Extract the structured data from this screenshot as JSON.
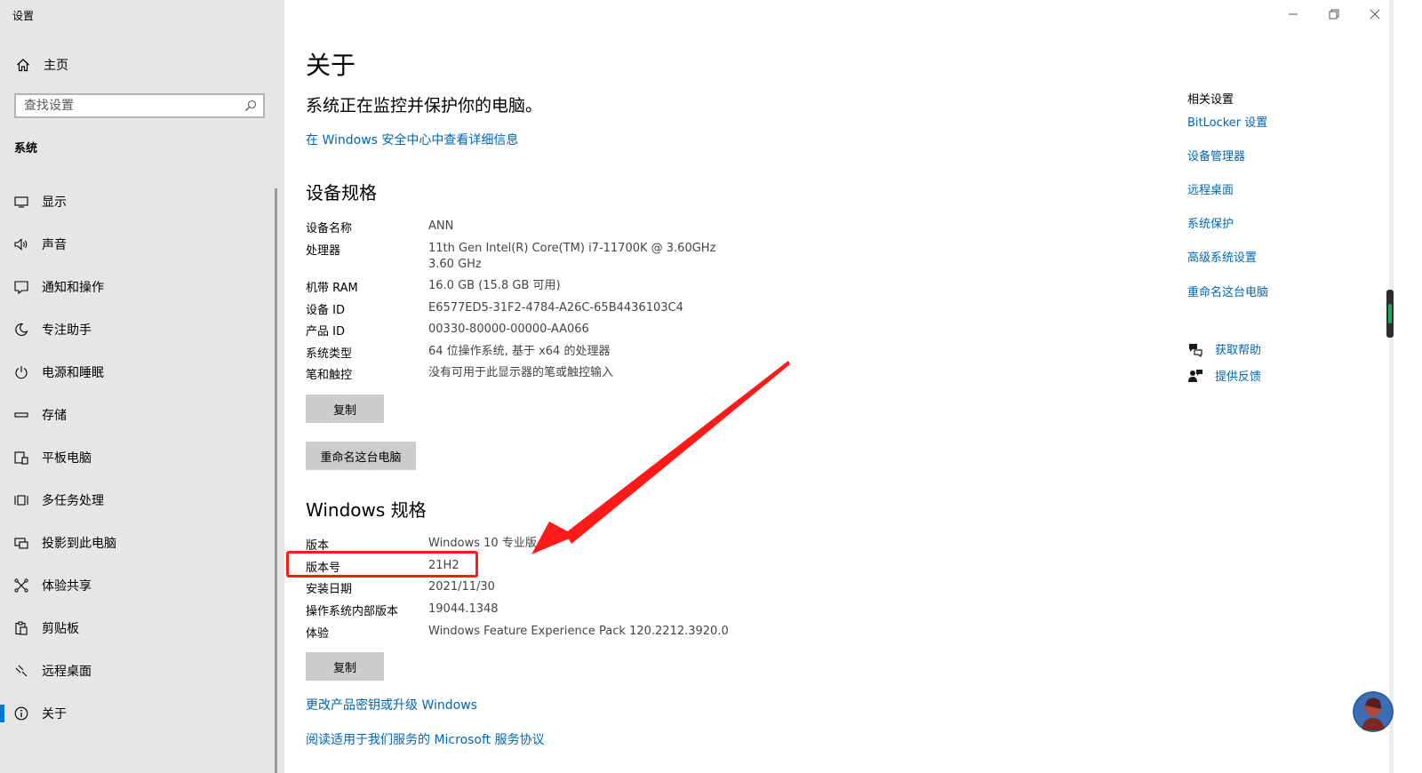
{
  "window": {
    "title": "设置"
  },
  "sidebar": {
    "home_label": "主页",
    "search_placeholder": "查找设置",
    "section_title": "系统",
    "items": [
      {
        "label": "显示",
        "icon": "display-icon"
      },
      {
        "label": "声音",
        "icon": "sound-icon"
      },
      {
        "label": "通知和操作",
        "icon": "notification-icon"
      },
      {
        "label": "专注助手",
        "icon": "focus-assist-icon"
      },
      {
        "label": "电源和睡眠",
        "icon": "power-icon"
      },
      {
        "label": "存储",
        "icon": "storage-icon"
      },
      {
        "label": "平板电脑",
        "icon": "tablet-icon"
      },
      {
        "label": "多任务处理",
        "icon": "multitasking-icon"
      },
      {
        "label": "投影到此电脑",
        "icon": "projecting-icon"
      },
      {
        "label": "体验共享",
        "icon": "shared-experiences-icon"
      },
      {
        "label": "剪贴板",
        "icon": "clipboard-icon"
      },
      {
        "label": "远程桌面",
        "icon": "remote-desktop-icon"
      },
      {
        "label": "关于",
        "icon": "info-icon",
        "selected": true
      }
    ]
  },
  "main": {
    "title": "关于",
    "status": "系统正在监控并保护你的电脑。",
    "security_link": "在 Windows 安全中心中查看详细信息",
    "device_specs": {
      "heading": "设备规格",
      "rows": [
        {
          "key": "设备名称",
          "value": "ANN"
        },
        {
          "key": "处理器",
          "value": "11th Gen Intel(R) Core(TM) i7-11700K @ 3.60GHz",
          "value2": "3.60 GHz"
        },
        {
          "key": "机带 RAM",
          "value": "16.0 GB (15.8 GB 可用)"
        },
        {
          "key": "设备 ID",
          "value": "E6577ED5-31F2-4784-A26C-65B4436103C4"
        },
        {
          "key": "产品 ID",
          "value": "00330-80000-00000-AA066"
        },
        {
          "key": "系统类型",
          "value": "64 位操作系统, 基于 x64 的处理器"
        },
        {
          "key": "笔和触控",
          "value": "没有可用于此显示器的笔或触控输入"
        }
      ],
      "copy_button": "复制",
      "rename_button": "重命名这台电脑"
    },
    "windows_specs": {
      "heading": "Windows 规格",
      "rows": [
        {
          "key": "版本",
          "value": "Windows 10 专业版"
        },
        {
          "key": "版本号",
          "value": "21H2"
        },
        {
          "key": "安装日期",
          "value": "2021/11/30"
        },
        {
          "key": "操作系统内部版本",
          "value": "19044.1348"
        },
        {
          "key": "体验",
          "value": "Windows Feature Experience Pack 120.2212.3920.0"
        }
      ],
      "copy_button": "复制"
    },
    "change_key_link": "更改产品密钥或升级 Windows",
    "agreement_link": "阅读适用于我们服务的 Microsoft 服务协议"
  },
  "related": {
    "title": "相关设置",
    "links": [
      "BitLocker 设置",
      "设备管理器",
      "远程桌面",
      "系统保护",
      "高级系统设置",
      "重命名这台电脑"
    ],
    "help_label": "获取帮助",
    "feedback_label": "提供反馈"
  },
  "colors": {
    "accent": "#0078d7",
    "link": "#0066b4",
    "annotation": "#ff1a1a",
    "sidebar_bg": "#e6e6e6",
    "button_bg": "#cccccc"
  }
}
